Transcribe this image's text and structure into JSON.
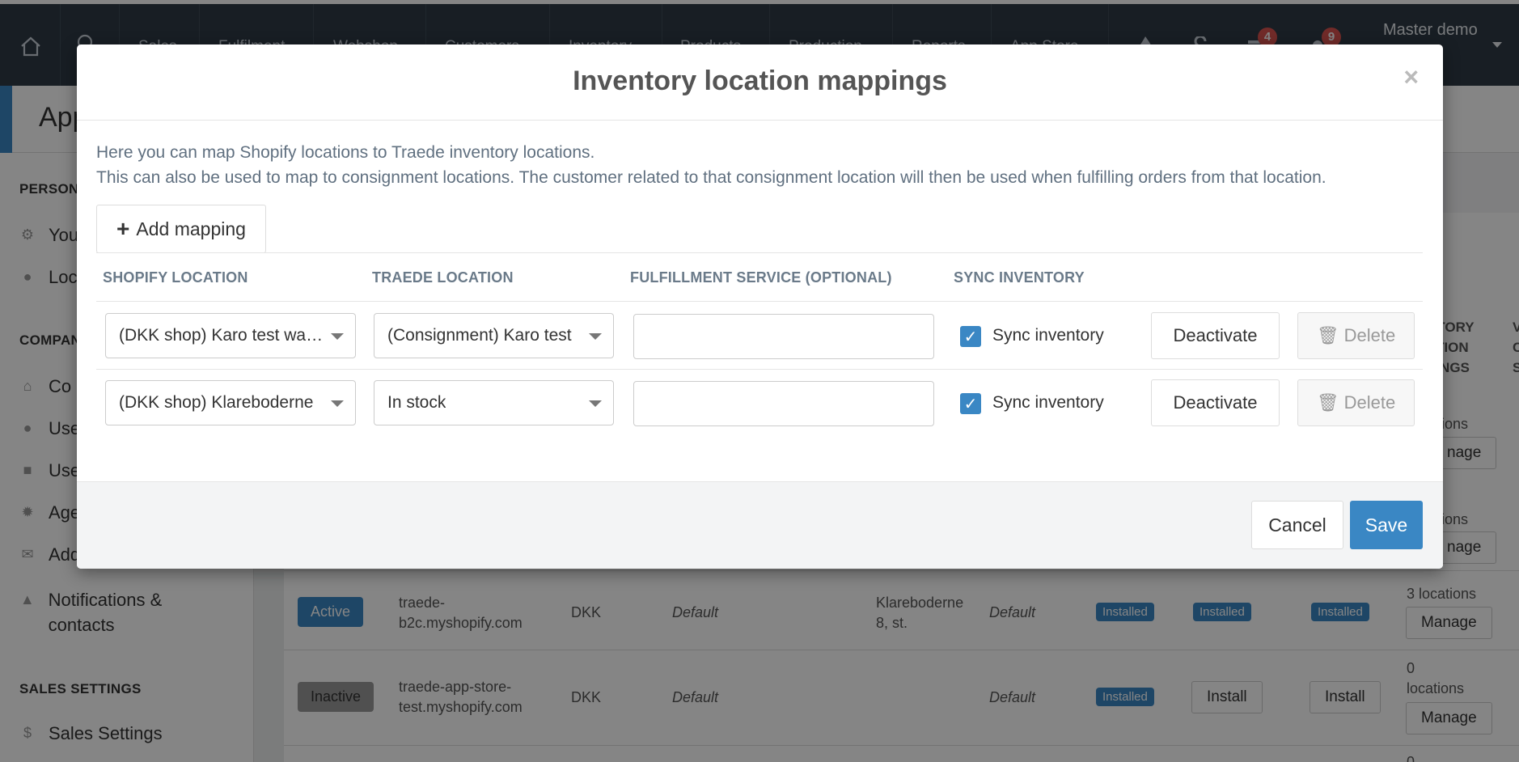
{
  "topnav": {
    "items": [
      "Sales",
      "Fulfilment",
      "Webshop",
      "Customers",
      "Inventory",
      "Products",
      "Production",
      "Reports",
      "App Store"
    ],
    "badge_tasks": "4",
    "badge_notifications": "9",
    "user": "Master demo"
  },
  "page": {
    "title": "App"
  },
  "sidebar": {
    "personal_heading": "PERSON",
    "personal_items": [
      "You",
      "Loc"
    ],
    "company_heading": "COMPAN",
    "company_items": [
      "Co",
      "Use",
      "Use",
      "Age",
      "Add"
    ],
    "notifications_label": "Notifications & contacts",
    "sales_heading": "SALES SETTINGS",
    "sales_item": "Sales Settings"
  },
  "background_table": {
    "col_inventory_mappings": "NTORY ATION PINGS",
    "col_last": "V C S",
    "rows": [
      {
        "locations": "ions",
        "manage": "nage"
      },
      {
        "locations": "ions",
        "manage": "nage"
      },
      {
        "status": "Active",
        "store": "traede-b2c.myshopify.com",
        "currency": "DKK",
        "pricelist": "Default",
        "address": "Klareboderne 8, st.",
        "default2": "Default",
        "inst1": "Installed",
        "inst2": "Installed",
        "inst3": "Installed",
        "locations": "3 locations",
        "manage": "Manage"
      },
      {
        "status": "Inactive",
        "store": "traede-app-store-test.myshopify.com",
        "currency": "DKK",
        "pricelist": "Default",
        "default2": "Default",
        "inst1": "Installed",
        "install2": "Install",
        "install3": "Install",
        "locations": "0 locations",
        "manage": "Manage"
      }
    ],
    "last_partial": "0"
  },
  "modal": {
    "title": "Inventory location mappings",
    "close": "×",
    "description_line1": "Here you can map Shopify locations to Traede inventory locations.",
    "description_line2": "This can also be used to map to consignment locations. The customer related to that consignment location will then be used when fulfilling orders from that location.",
    "add_button": "Add mapping",
    "columns": {
      "shopify": "SHOPIFY LOCATION",
      "traede": "TRAEDE LOCATION",
      "fulfillment": "FULFILLMENT SERVICE (OPTIONAL)",
      "sync": "SYNC INVENTORY"
    },
    "rows": [
      {
        "shopify_location": "(DKK shop) Karo test warehouse",
        "traede_location": "(Consignment) Karo test",
        "fulfillment_service": "",
        "sync_checked": true,
        "sync_label": "Sync inventory",
        "deactivate": "Deactivate",
        "delete": "Delete"
      },
      {
        "shopify_location": "(DKK shop) Klareboderne",
        "traede_location": "In stock",
        "fulfillment_service": "",
        "sync_checked": true,
        "sync_label": "Sync inventory",
        "deactivate": "Deactivate",
        "delete": "Delete"
      }
    ],
    "cancel": "Cancel",
    "save": "Save"
  },
  "colors": {
    "primary": "#3a87c4",
    "topbar": "#2f3a45",
    "badge": "#d9534f"
  }
}
